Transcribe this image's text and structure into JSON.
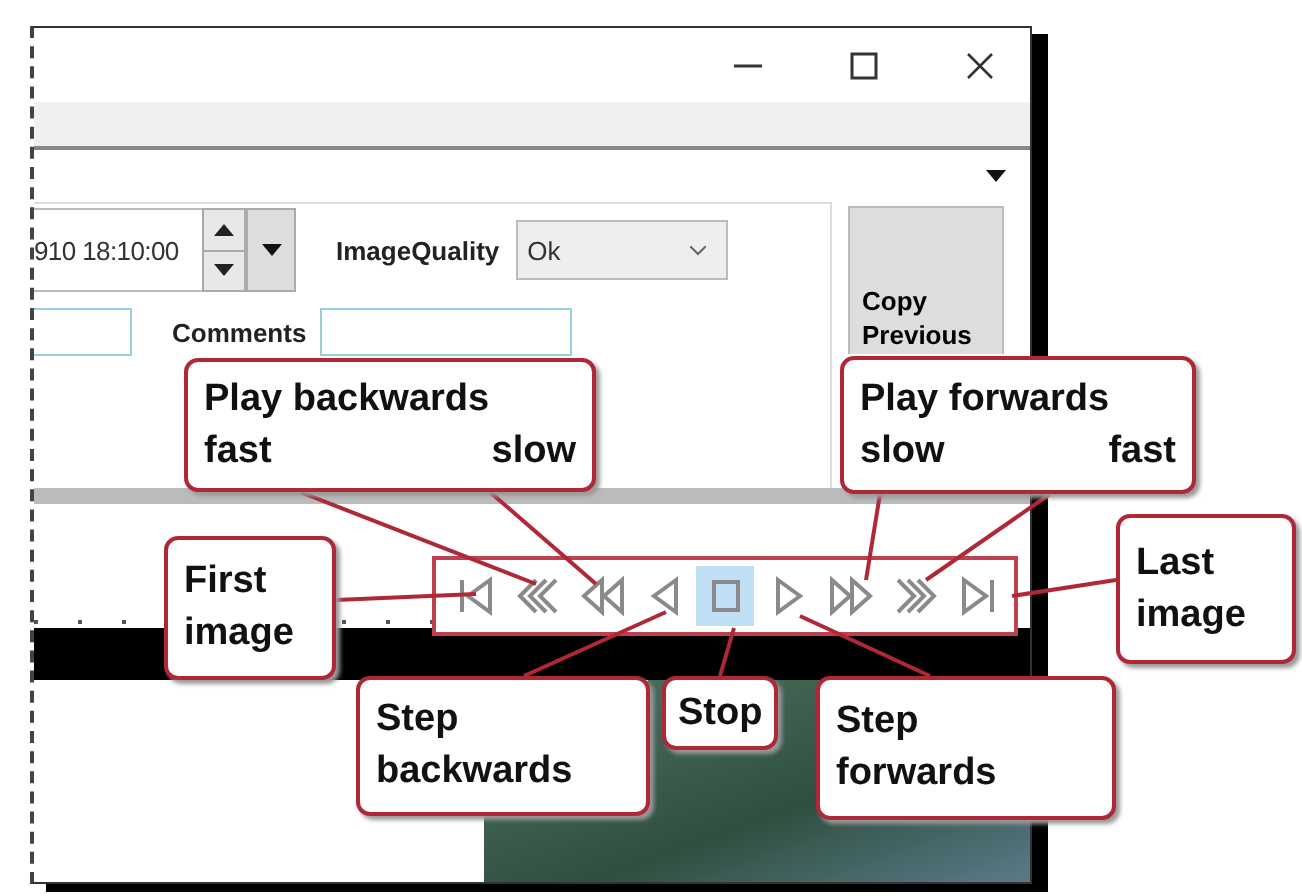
{
  "form": {
    "datetime_value": "910 18:10:00",
    "image_quality_label": "ImageQuality",
    "image_quality_value": "Ok",
    "comments_label": "Comments",
    "copy_button": "Copy Previous"
  },
  "player": {
    "buttons": [
      {
        "kind": "first",
        "selected": false
      },
      {
        "kind": "fastback",
        "selected": false
      },
      {
        "kind": "back",
        "selected": false
      },
      {
        "kind": "stepback",
        "selected": false
      },
      {
        "kind": "stop",
        "selected": true
      },
      {
        "kind": "stepfwd",
        "selected": false
      },
      {
        "kind": "fwd",
        "selected": false
      },
      {
        "kind": "fastfwd",
        "selected": false
      },
      {
        "kind": "last",
        "selected": false
      }
    ]
  },
  "callouts": [
    {
      "lines": [
        [
          "Play backwards"
        ],
        [
          "fast",
          "slow"
        ]
      ]
    },
    {
      "lines": [
        [
          "Play forwards"
        ],
        [
          "slow",
          "fast"
        ]
      ]
    },
    {
      "lines": [
        [
          "First"
        ],
        [
          "image"
        ]
      ]
    },
    {
      "lines": [
        [
          "Last"
        ],
        [
          "image"
        ]
      ]
    },
    {
      "lines": [
        [
          "Step"
        ],
        [
          "backwards"
        ]
      ]
    },
    {
      "lines": [
        [
          "Stop"
        ]
      ]
    },
    {
      "lines": [
        [
          "Step"
        ],
        [
          "forwards"
        ]
      ]
    }
  ]
}
